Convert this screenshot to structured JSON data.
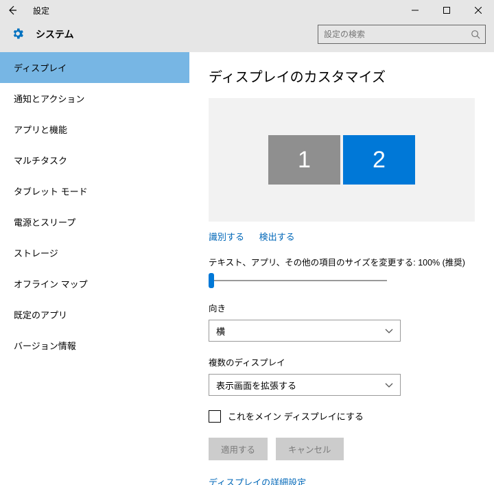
{
  "titlebar": {
    "title": "設定"
  },
  "header": {
    "app_title": "システム",
    "search_placeholder": "設定の検索"
  },
  "sidebar": {
    "items": [
      {
        "label": "ディスプレイ",
        "selected": true
      },
      {
        "label": "通知とアクション"
      },
      {
        "label": "アプリと機能"
      },
      {
        "label": "マルチタスク"
      },
      {
        "label": "タブレット モード"
      },
      {
        "label": "電源とスリープ"
      },
      {
        "label": "ストレージ"
      },
      {
        "label": "オフライン マップ"
      },
      {
        "label": "既定のアプリ"
      },
      {
        "label": "バージョン情報"
      }
    ]
  },
  "main": {
    "heading": "ディスプレイのカスタマイズ",
    "monitors": {
      "m1": "1",
      "m2": "2"
    },
    "identify_label": "識別する",
    "detect_label": "検出する",
    "scale_label": "テキスト、アプリ、その他の項目のサイズを変更する: 100% (推奨)",
    "orientation_label": "向き",
    "orientation_value": "横",
    "multi_label": "複数のディスプレイ",
    "multi_value": "表示画面を拡張する",
    "make_main_label": "これをメイン ディスプレイにする",
    "apply_label": "適用する",
    "cancel_label": "キャンセル",
    "advanced_label": "ディスプレイの詳細設定"
  }
}
